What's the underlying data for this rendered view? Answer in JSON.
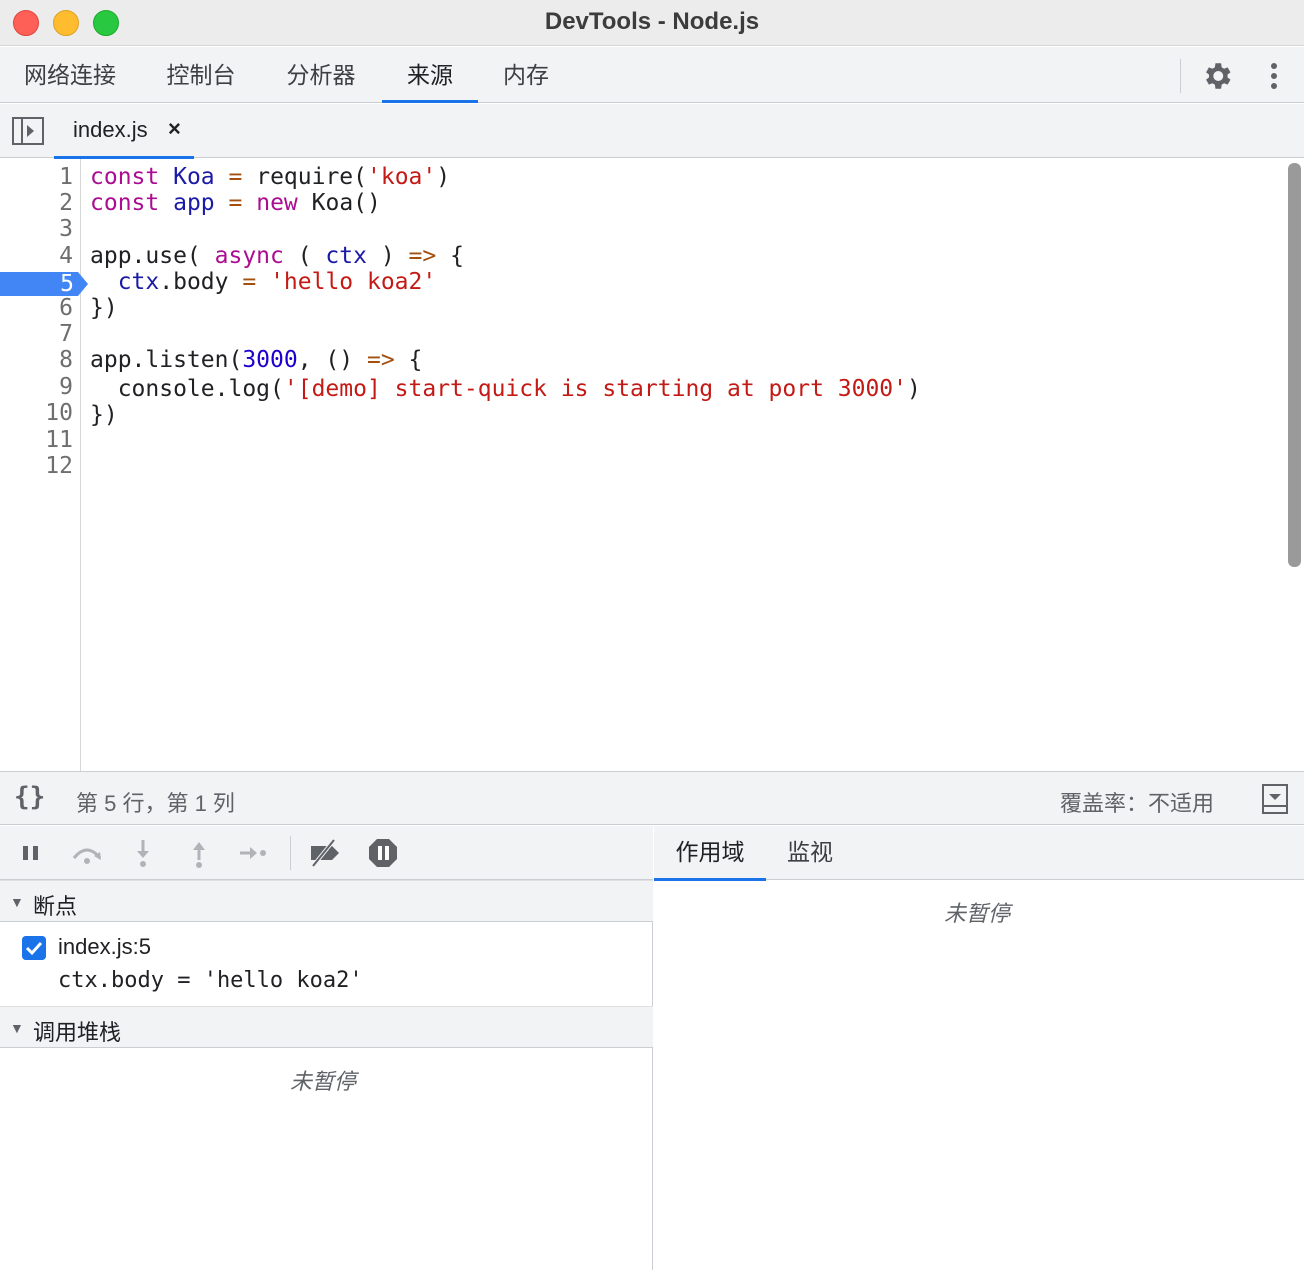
{
  "window": {
    "title": "DevTools - Node.js"
  },
  "main_tabs": [
    {
      "label": "网络连接",
      "active": false
    },
    {
      "label": "控制台",
      "active": false
    },
    {
      "label": "分析器",
      "active": false
    },
    {
      "label": "来源",
      "active": true
    },
    {
      "label": "内存",
      "active": false
    }
  ],
  "toolbar_icons": {
    "settings": "gear-icon",
    "more": "kebab-icon"
  },
  "file_tab": {
    "name": "index.js",
    "close": "×"
  },
  "editor": {
    "line_numbers": [
      "1",
      "2",
      "3",
      "4",
      "5",
      "6",
      "7",
      "8",
      "9",
      "10",
      "11",
      "12"
    ],
    "breakpoint_line": "5",
    "lines": [
      "const Koa = require('koa')",
      "const app = new Koa()",
      "",
      "app.use( async ( ctx ) => {",
      "  ctx.body = 'hello koa2'",
      "})",
      "",
      "app.listen(3000, () => {",
      "  console.log('[demo] start-quick is starting at port 3000')",
      "})",
      "",
      ""
    ]
  },
  "status_bar": {
    "format_icon": "{}",
    "position": "第 5 行，第 1 列",
    "coverage": "覆盖率：不适用"
  },
  "debugger": {
    "breakpoints_title": "断点",
    "breakpoint": {
      "file": "index.js:5",
      "code": "ctx.body = 'hello koa2'",
      "checked": true
    },
    "callstack_title": "调用堆栈",
    "callstack_empty": "未暂停"
  },
  "scope_tabs": [
    {
      "label": "作用域",
      "active": true
    },
    {
      "label": "监视",
      "active": false
    }
  ],
  "scope_empty": "未暂停",
  "colors": {
    "accent": "#1a73e8",
    "keyword": "#aa0d91",
    "string": "#c41a16",
    "number": "#1c00cf"
  }
}
